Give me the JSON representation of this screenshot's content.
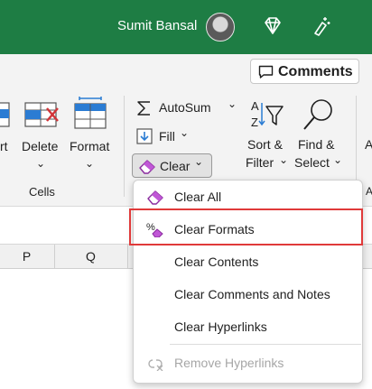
{
  "titlebar": {
    "user_name": "Sumit Bansal",
    "icons": [
      "diamond-icon",
      "magic-wand-icon"
    ],
    "color": "#1e7d44"
  },
  "ribbon": {
    "comments_label": "Comments",
    "cells_group": {
      "insert_label_partial": "rt",
      "delete_label": "Delete",
      "format_label": "Format",
      "group_label": "Cells"
    },
    "editing_group": {
      "autosum_label": "AutoSum",
      "fill_label": "Fill",
      "clear_label": "Clear",
      "sort_filter_label_line1": "Sort &",
      "sort_filter_label_line2": "Filter",
      "find_select_label_line1": "Find &",
      "find_select_label_line2": "Select",
      "partial_right_label": "A",
      "partial_group_label": "A"
    }
  },
  "columns": [
    "P",
    "Q"
  ],
  "clear_menu": {
    "items": [
      {
        "label": "Clear All",
        "icon": "eraser-icon",
        "enabled": true
      },
      {
        "label": "Clear Formats",
        "icon": "percent-eraser-icon",
        "enabled": true,
        "highlighted": true
      },
      {
        "label": "Clear Contents",
        "icon": "",
        "enabled": true
      },
      {
        "label": "Clear Comments and Notes",
        "icon": "",
        "enabled": true
      },
      {
        "label": "Clear Hyperlinks",
        "icon": "",
        "enabled": true
      },
      {
        "label": "Remove Hyperlinks",
        "icon": "unlink-icon",
        "enabled": false
      }
    ]
  }
}
